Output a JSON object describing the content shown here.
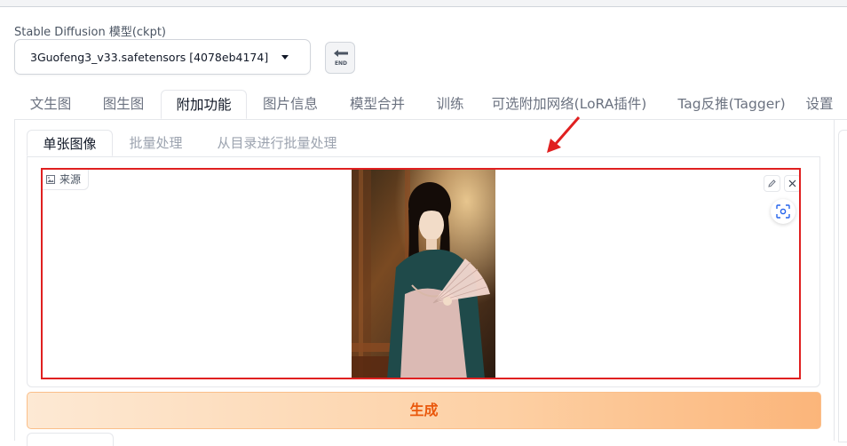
{
  "model": {
    "label": "Stable Diffusion 模型(ckpt)",
    "selected": "3Guofeng3_v33.safetensors [4078eb4174]",
    "end_button_text": "END"
  },
  "main_tabs": [
    {
      "label": "文生图"
    },
    {
      "label": "图生图"
    },
    {
      "label": "附加功能",
      "active": true
    },
    {
      "label": "图片信息"
    },
    {
      "label": "模型合并"
    },
    {
      "label": "训练"
    },
    {
      "label": "可选附加网络(LoRA插件)"
    },
    {
      "label": "Tag反推(Tagger)"
    },
    {
      "label": "设置"
    }
  ],
  "sub_tabs": [
    {
      "label": "单张图像",
      "active": true
    },
    {
      "label": "批量处理"
    },
    {
      "label": "从目录进行批量处理"
    }
  ],
  "image_input": {
    "source_label": "来源",
    "icons": [
      "image-icon",
      "pencil-icon",
      "close-icon",
      "camera-capture-icon"
    ]
  },
  "generate_label": "生成",
  "colors": {
    "highlight_border": "#e02020",
    "generate_text": "#ea580c",
    "generate_gradient_start": "#fde9d4",
    "generate_gradient_end": "#fbb57a"
  }
}
